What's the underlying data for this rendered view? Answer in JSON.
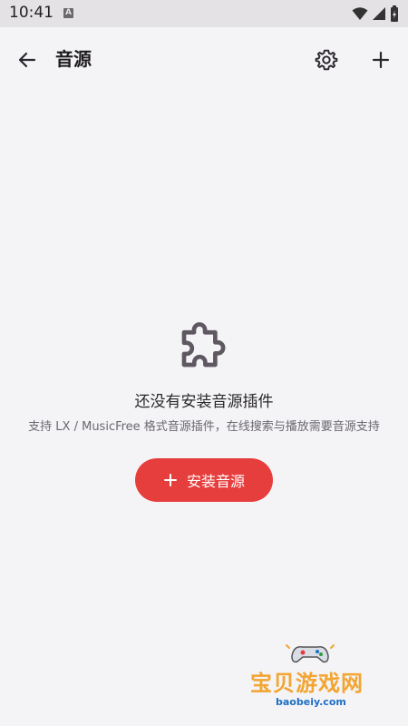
{
  "status_bar": {
    "time": "10:41",
    "notification_letter": "A"
  },
  "app_bar": {
    "title": "音源",
    "icons": [
      "back-arrow-icon",
      "gear-icon",
      "plus-icon"
    ]
  },
  "empty_state": {
    "icon": "puzzle-icon",
    "title": "还没有安装音源插件",
    "description": "支持 LX / MusicFree 格式音源插件，在线搜索与播放需要音源支持"
  },
  "install_button": {
    "label": "安装音源",
    "color": "#e63d3d"
  },
  "watermark": {
    "text": "宝贝游戏网",
    "url": "baobeiy.com"
  },
  "colors": {
    "background": "#f4f3f6",
    "accent": "#e63d3d",
    "icon": "#5f5862"
  }
}
